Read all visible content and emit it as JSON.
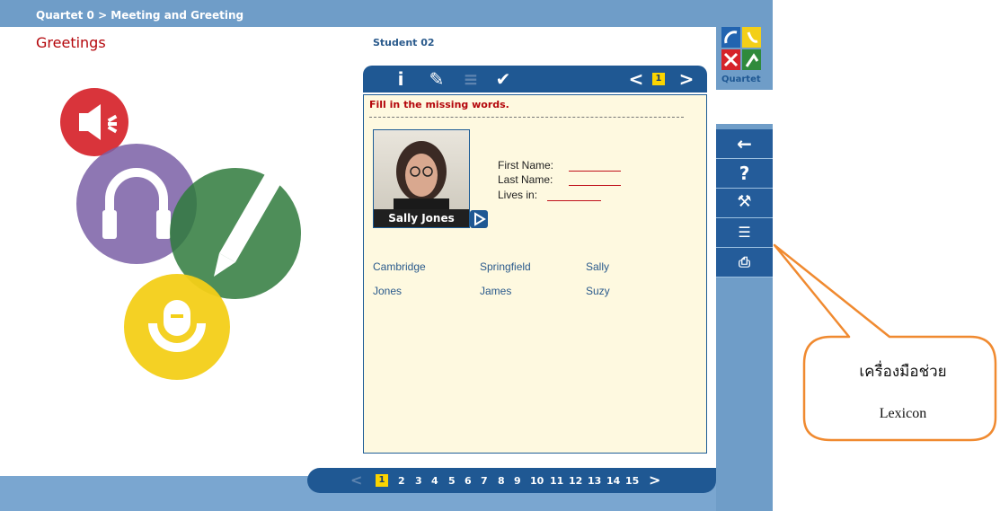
{
  "breadcrumb": "Quartet 0 > Meeting and Greeting",
  "section_title": "Greetings",
  "student": "Student 02",
  "logo_text": "Quartet",
  "toolbar": {
    "icons": [
      "info-icon",
      "rubber-icon",
      "list-icon",
      "check-icon"
    ],
    "page": "1"
  },
  "exercise": {
    "instruction": "Fill in the missing words.",
    "photo_name": "Sally Jones",
    "fields": [
      "First Name:",
      "Last Name:",
      "Lives in:"
    ],
    "words": [
      [
        "Cambridge",
        "Springfield",
        "Sally"
      ],
      [
        "Jones",
        "James",
        "Suzy"
      ]
    ]
  },
  "sidebar": {
    "buttons": [
      "back-arrow-icon",
      "help-icon",
      "tools-icon",
      "lexicon-icon",
      "print-icon"
    ]
  },
  "pager": {
    "current": "1",
    "pages": [
      "1",
      "2",
      "3",
      "4",
      "5",
      "6",
      "7",
      "8",
      "9",
      "10",
      "11",
      "12",
      "13",
      "14",
      "15"
    ]
  },
  "callout": {
    "line1": "เครื่องมือช่วย",
    "line2": "Lexicon"
  },
  "colors": {
    "accent_blue": "#1f5893",
    "frame_blue": "#6f9dc8",
    "title_red": "#b4060b",
    "callout_orange": "#f08a30"
  }
}
